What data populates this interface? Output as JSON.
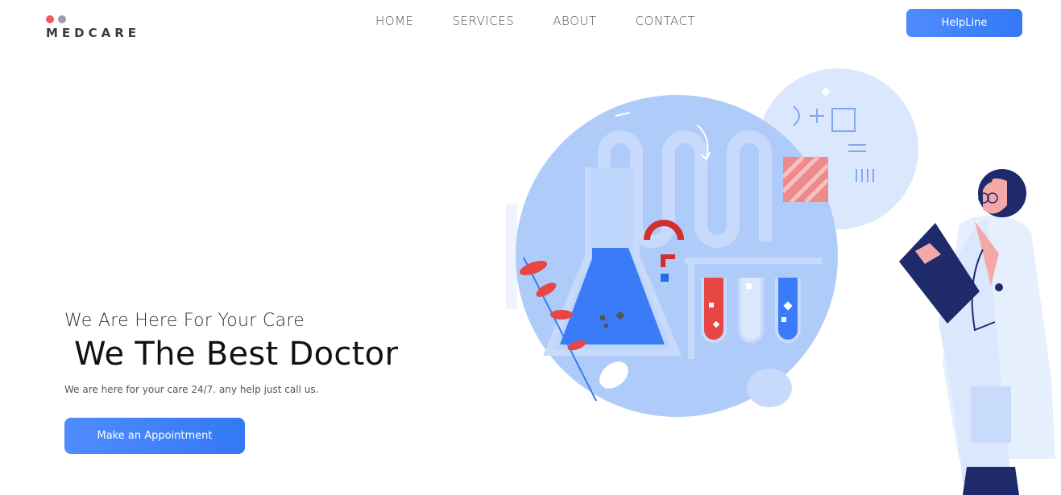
{
  "brand": {
    "name": "MEDCARE",
    "dot_colors": [
      "#f25a5a",
      "#9aa0a8"
    ]
  },
  "nav": {
    "items": [
      "HOME",
      "SERVICES",
      "ABOUT",
      "CONTACT"
    ]
  },
  "header": {
    "helpline_label": "HelpLine"
  },
  "hero": {
    "tagline": "We Are Here For Your Care",
    "headline": "We The Best Doctor",
    "subtext": "We are here for your care 24/7. any help just call us.",
    "cta_label": "Make an Appointment"
  },
  "colors": {
    "accent": "#3a7bf7",
    "circle": "#aecbfa",
    "circle_light": "#dbe7fd",
    "red": "#e84545",
    "navy": "#1f2a6b"
  }
}
